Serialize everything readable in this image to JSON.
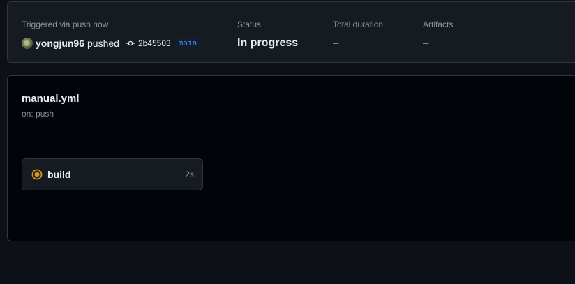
{
  "summary": {
    "trigger_label": "Triggered via push now",
    "username": "yongjun96",
    "action": "pushed",
    "commit_sha": "2b45503",
    "branch": "main",
    "status_label": "Status",
    "status_value": "In progress",
    "duration_label": "Total duration",
    "duration_value": "–",
    "artifacts_label": "Artifacts",
    "artifacts_value": "–"
  },
  "workflow": {
    "file_name": "manual.yml",
    "trigger": "on: push",
    "jobs": [
      {
        "name": "build",
        "duration": "2s",
        "status": "in-progress",
        "status_icon": "in-progress-icon"
      }
    ]
  },
  "colors": {
    "page_bg": "#0d1117",
    "card_bg": "#161b22",
    "graph_bg": "#010409",
    "border": "#30363d",
    "in_progress": "#d29922",
    "branch_accent": "#4493f8"
  }
}
